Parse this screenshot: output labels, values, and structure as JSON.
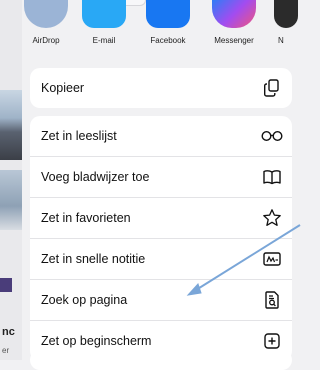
{
  "background": {
    "text1": "nc",
    "text2": "er"
  },
  "share_apps": [
    {
      "label": "AirDrop",
      "color": "#9bb4d6"
    },
    {
      "label": "E-mail",
      "color": "#29a8f5"
    },
    {
      "label": "Facebook",
      "color": "#1877f2"
    },
    {
      "label": "Messenger",
      "color": "#7b5cf0"
    },
    {
      "label": "N",
      "color": "#2b2b2b"
    }
  ],
  "actions_group1": [
    {
      "label": "Kopieer",
      "icon": "copy-icon"
    }
  ],
  "actions_group2": [
    {
      "label": "Zet in leeslijst",
      "icon": "glasses-icon"
    },
    {
      "label": "Voeg bladwijzer toe",
      "icon": "book-icon"
    },
    {
      "label": "Zet in favorieten",
      "icon": "star-icon"
    },
    {
      "label": "Zet in snelle notitie",
      "icon": "quick-note-icon"
    },
    {
      "label": "Zoek op pagina",
      "icon": "find-on-page-icon"
    },
    {
      "label": "Zet op beginscherm",
      "icon": "add-square-icon"
    }
  ],
  "annotation_color": "#7aa6d8"
}
